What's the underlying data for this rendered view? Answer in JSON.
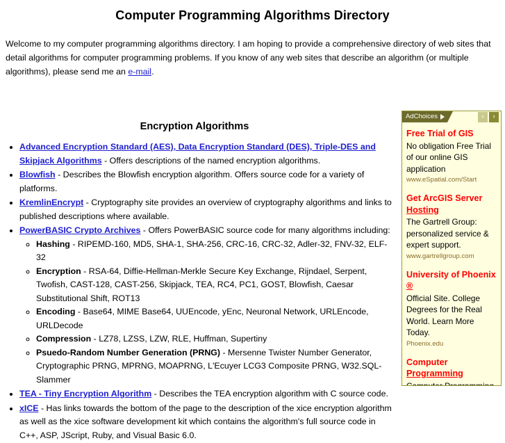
{
  "page": {
    "title": "Computer Programming Algorithms Directory",
    "intro_before_link": "Welcome to my computer programming algorithms directory. I am hoping to provide a comprehensive directory of web sites that detail algorithms for computer programming problems. If you know of any web sites that describe an algorithm (or multiple algorithms), please send me an ",
    "intro_link": "e-mail",
    "intro_after_link": ".",
    "link_color": "#2020d0"
  },
  "main": {
    "section_title": "Encryption Algorithms",
    "items": [
      {
        "link": "Advanced Encryption Standard (AES), Data Encryption Standard (DES), Triple-DES and Skipjack Algorithms",
        "desc": " - Offers descriptions of the named encryption algorithms."
      },
      {
        "link": "Blowfish",
        "desc": " - Describes the Blowfish encryption algorithm. Offers source code for a variety of platforms."
      },
      {
        "link": "KremlinEncrypt",
        "desc": " - Cryptography site provides an overview of cryptography algorithms and links to published descriptions where available."
      },
      {
        "link": "PowerBASIC Crypto Archives",
        "desc": " - Offers PowerBASIC source code for many algorithms including:",
        "sub_items": [
          {
            "label": "Hashing",
            "desc": " - RIPEMD-160, MD5, SHA-1, SHA-256, CRC-16, CRC-32, Adler-32, FNV-32, ELF-32"
          },
          {
            "label": "Encryption",
            "desc": " - RSA-64, Diffie-Hellman-Merkle Secure Key Exchange, Rijndael, Serpent, Twofish, CAST-128, CAST-256, Skipjack, TEA, RC4, PC1, GOST, Blowfish, Caesar Substitutional Shift, ROT13"
          },
          {
            "label": "Encoding",
            "desc": " - Base64, MIME Base64, UUEncode, yEnc, Neuronal Network, URLEncode, URLDecode"
          },
          {
            "label": "Compression",
            "desc": " - LZ78, LZSS, LZW, RLE, Huffman, Supertiny"
          },
          {
            "label": "Psuedo-Random Number Generation (PRNG)",
            "desc": " - Mersenne Twister Number Generator, Cryptographic PRNG, MPRNG, MOAPRNG, L'Ecuyer LCG3 Composite PRNG, W32.SQL-Slammer"
          }
        ]
      },
      {
        "link": "TEA - Tiny Encryption Algorithm",
        "desc": " - Describes the TEA encryption algorithm with C source code."
      },
      {
        "link": "xICE",
        "desc": " - Has links towards the bottom of the page to the description of the xice encryption algorithm as well as the xice software development kit which contains the algorithm's full source code in C++, ASP, JScript, Ruby, and Visual Basic 6.0."
      }
    ]
  },
  "ads": {
    "adchoices_label": "AdChoices",
    "adchoices_icon": "triangle-right-icon",
    "prev_label": "‹",
    "next_label": "›",
    "background_color": "#ffffe0",
    "border_color": "#9a9a3a",
    "tab_color": "#6c6b2b",
    "title_color": "#ff0000",
    "url_color": "#8a6a2a",
    "items": [
      {
        "title": "Free Trial of GIS",
        "title_underline": "",
        "text": "No obligation Free Trial of our online GIS application",
        "url": "www.eSpatial.com/Start"
      },
      {
        "title": "Get ArcGIS Server ",
        "title_underline": "Hosting",
        "text": "The Gartrell Group: personalized service & expert support.",
        "url": "www.gartrellgroup.com"
      },
      {
        "title": "University of Phoenix ",
        "title_underline": "®",
        "text": "Official Site. College Degrees for the Real World. Learn More Today.",
        "url": "Phoenix.edu"
      },
      {
        "title": "Computer ",
        "title_underline": "Programming",
        "text": "Computer Programming",
        "url": ""
      }
    ]
  }
}
